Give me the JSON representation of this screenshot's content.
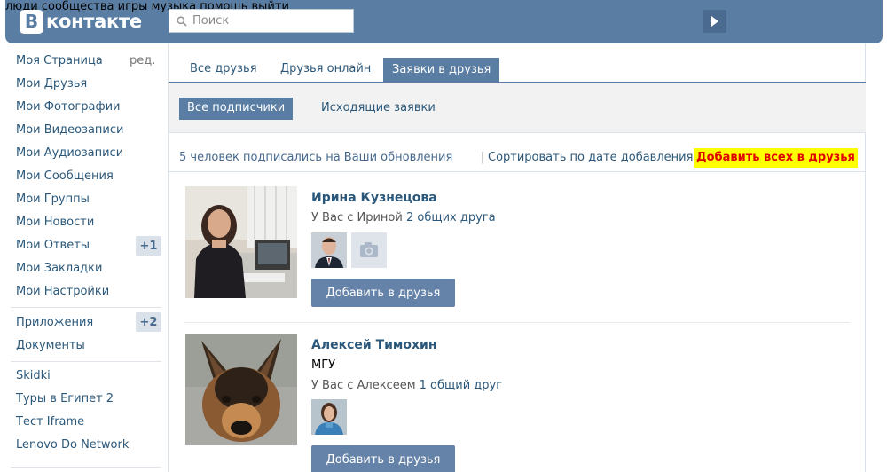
{
  "header": {
    "logo_letter": "В",
    "logo_text": "контакте",
    "search_placeholder": "Поиск",
    "nav": [
      {
        "label": "люди"
      },
      {
        "label": "сообщества"
      },
      {
        "label": "игры"
      },
      {
        "label": "музыка"
      },
      {
        "label": "помощь"
      },
      {
        "label": "выйти"
      }
    ],
    "brand_color": "#597da3"
  },
  "sidebar": {
    "edit_label": "ред.",
    "items": [
      {
        "label": "Моя Страница"
      },
      {
        "label": "Мои Друзья"
      },
      {
        "label": "Мои Фотографии"
      },
      {
        "label": "Мои Видеозаписи"
      },
      {
        "label": "Мои Аудиозаписи"
      },
      {
        "label": "Мои Сообщения"
      },
      {
        "label": "Мои Группы"
      },
      {
        "label": "Мои Новости"
      },
      {
        "label": "Мои Ответы",
        "badge": "+1"
      },
      {
        "label": "Мои Закладки"
      },
      {
        "label": "Мои Настройки"
      },
      {
        "label": "Приложения",
        "badge": "+2"
      },
      {
        "label": "Документы"
      },
      {
        "label": "Skidki"
      },
      {
        "label": "Туры в Египет 2"
      },
      {
        "label": "Тест Iframe"
      },
      {
        "label": "Lenovo Do Network"
      }
    ]
  },
  "main": {
    "tabs": [
      {
        "label": "Все друзья"
      },
      {
        "label": "Друзья онлайн"
      },
      {
        "label": "Заявки в друзья",
        "active": true
      }
    ],
    "subtabs": [
      {
        "label": "Все подписчики",
        "active": true
      },
      {
        "label": "Исходящие заявки"
      }
    ],
    "summary": {
      "count_text": "5 человек подписались на Ваши обновления",
      "divider": "|",
      "sort_text": "Сортировать по дате добавления",
      "add_all": "Добавить всех в друзья"
    },
    "requests": [
      {
        "name": "Ирина Кузнецова",
        "mutual_prefix": "У Вас с Ириной ",
        "mutual_count": "2 общих друга",
        "add_button": "Добавить в друзья"
      },
      {
        "name": "Алексей Тимохин",
        "subtitle": "МГУ",
        "mutual_prefix": "У Вас с Алексеем ",
        "mutual_count": "1 общий друг",
        "add_button": "Добавить в друзья"
      }
    ]
  }
}
